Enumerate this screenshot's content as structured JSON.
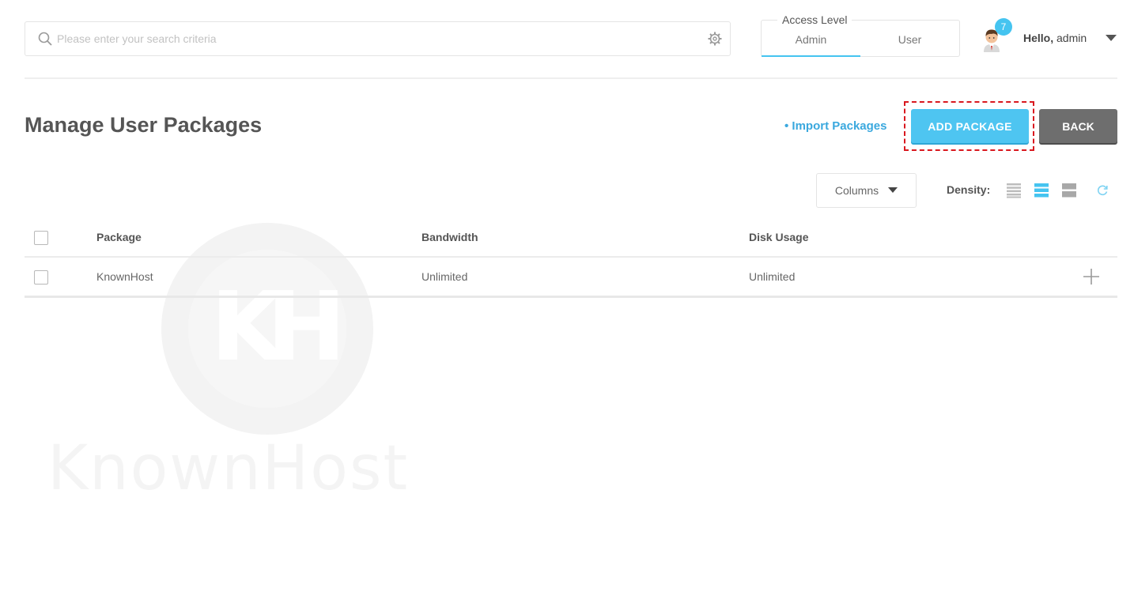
{
  "header": {
    "search": {
      "placeholder": "Please enter your search criteria",
      "value": ""
    },
    "access_level": {
      "title": "Access Level",
      "tabs": [
        {
          "label": "Admin",
          "active": true
        },
        {
          "label": "User",
          "active": false
        }
      ]
    },
    "user": {
      "greeting": "Hello,",
      "name": "admin",
      "notification_count": "7"
    }
  },
  "page": {
    "title": "Manage User Packages",
    "import_link": "• Import Packages",
    "add_button": "ADD PACKAGE",
    "back_button": "BACK"
  },
  "toolbar": {
    "columns_label": "Columns",
    "density_label": "Density:"
  },
  "table": {
    "headers": [
      "Package",
      "Bandwidth",
      "Disk Usage"
    ],
    "rows": [
      {
        "package": "KnownHost",
        "bandwidth": "Unlimited",
        "disk_usage": "Unlimited"
      }
    ]
  },
  "watermark": {
    "text": "KnownHost",
    "mark": "KH"
  },
  "colors": {
    "accent": "#45c4f0",
    "link": "#3aa8de",
    "back": "#6e6e6e",
    "highlight": "#d9181f"
  },
  "icons": [
    "search-icon",
    "gear-icon",
    "avatar-icon",
    "caret-down-icon",
    "density-compact-icon",
    "density-standard-icon",
    "density-comfortable-icon",
    "refresh-icon",
    "plus-icon"
  ]
}
